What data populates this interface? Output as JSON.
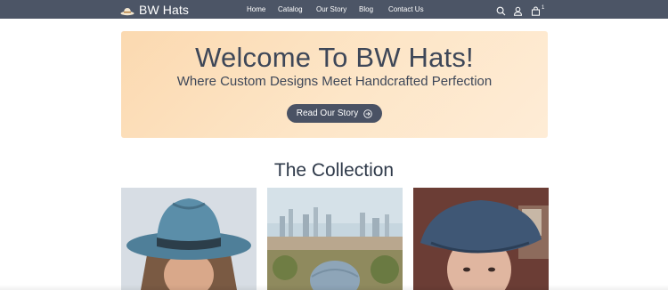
{
  "header": {
    "brand": "BW Hats",
    "nav": [
      "Home",
      "Catalog",
      "Our Story",
      "Blog",
      "Contact Us"
    ],
    "cart_count": "1",
    "icons": [
      "search-icon",
      "account-icon",
      "cart-icon"
    ]
  },
  "hero": {
    "title": "Welcome To BW Hats!",
    "subtitle": "Where Custom Designs Meet Handcrafted Perfection",
    "button_label": "Read Our Story"
  },
  "collection": {
    "title": "The Collection",
    "items": [
      "blue-fedora-photo",
      "city-cap-photo",
      "flat-cap-photo"
    ]
  },
  "colors": {
    "header_bg": "#4c5566",
    "hero_bg": "#fcdcb4",
    "button_bg": "#4a5264",
    "text": "#3e4758"
  }
}
